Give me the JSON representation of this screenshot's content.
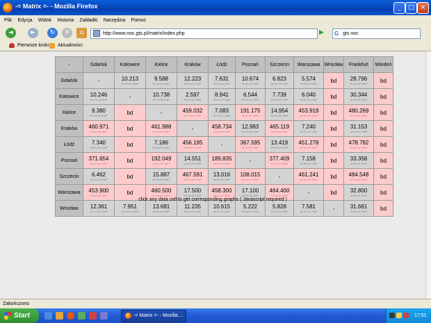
{
  "window": {
    "title": "-= Matrix =- - Mozilla Firefox"
  },
  "window_controls": {
    "minimize": "_",
    "maximize": "□",
    "close": "×"
  },
  "menu": [
    "Plik",
    "Edycja",
    "Widok",
    "Historia",
    "Zakładki",
    "Narzędzia",
    "Pomoc"
  ],
  "nav": {
    "back": "◄",
    "forward": "►",
    "reload": "↻",
    "stop": "✕",
    "home": "⌂",
    "go": "▶"
  },
  "address": {
    "url": "http://www.noc.gts.pl/matrix/index.php"
  },
  "search": {
    "engine_icon": "G",
    "value": "gts noc"
  },
  "bookmarks": [
    "Pierwsze kroki",
    "Aktualności"
  ],
  "matrix": {
    "corner": "-",
    "columns": [
      "Gdańsk",
      "Katowice",
      "Kielce",
      "Kraków",
      "Łódź",
      "Poznań",
      "Szczecin",
      "Warszawa",
      "Wrocław",
      "Frankfurt",
      "Wiedeń"
    ],
    "rows": [
      {
        "name": "Gdańsk",
        "cells": [
          {
            "v": "-",
            "c": "g"
          },
          {
            "v": "10.213",
            "t": "15:31:02 GMT",
            "c": "g"
          },
          {
            "v": "9.588",
            "t": "15:31:02 GMT",
            "c": "g"
          },
          {
            "v": "12.223",
            "t": "15:31:02 GMT",
            "c": "g"
          },
          {
            "v": "7.631",
            "t": "15:31:02 GMT",
            "c": "g"
          },
          {
            "v": "10.674",
            "t": "15:31:02 GMT",
            "c": "g"
          },
          {
            "v": "6.823",
            "t": "15:31:02 GMT",
            "c": "g"
          },
          {
            "v": "5.574",
            "t": "15:31:02 GMT",
            "c": "g"
          },
          {
            "v": "bd",
            "c": "r"
          },
          {
            "v": "28.796",
            "t": "15:31:02 GMT",
            "c": "g"
          },
          {
            "v": "bd",
            "c": "r"
          }
        ]
      },
      {
        "name": "Katowice",
        "cells": [
          {
            "v": "10.246",
            "t": "15:31:02 GMT",
            "c": "g"
          },
          {
            "v": "-",
            "c": "g"
          },
          {
            "v": "10.738",
            "t": "15:31:02 GMT",
            "c": "g"
          },
          {
            "v": "2.597",
            "t": "15:31:02 GMT",
            "c": "g"
          },
          {
            "v": "8.941",
            "t": "15:31:02 GMT",
            "c": "g"
          },
          {
            "v": "6.544",
            "t": "15:31:02 GMT",
            "c": "g"
          },
          {
            "v": "7.739",
            "t": "15:31:02 GMT",
            "c": "g"
          },
          {
            "v": "6.040",
            "t": "15:31:02 GMT",
            "c": "g"
          },
          {
            "v": "bd",
            "c": "r"
          },
          {
            "v": "30.344",
            "t": "15:31:02 GMT",
            "c": "g"
          },
          {
            "v": "bd",
            "c": "r"
          }
        ]
      },
      {
        "name": "Kielce",
        "cells": [
          {
            "v": "9.380",
            "t": "15:31:02 GMT",
            "c": "g"
          },
          {
            "v": "bd",
            "c": "r"
          },
          {
            "v": "-",
            "c": "g"
          },
          {
            "v": "459.032",
            "t": "15:31:02 GMT",
            "c": "r"
          },
          {
            "v": "7.083",
            "t": "15:31:02 GMT",
            "c": "g"
          },
          {
            "v": "191.175",
            "t": "15:31:02 GMT",
            "c": "r"
          },
          {
            "v": "14.954",
            "t": "15:31:02 GMT",
            "c": "g"
          },
          {
            "v": "453.919",
            "t": "15:31:02 GMT",
            "c": "r"
          },
          {
            "v": "bd",
            "c": "r"
          },
          {
            "v": "480.269",
            "t": "15:31:02 GMT",
            "c": "r"
          },
          {
            "v": "bd",
            "c": "r"
          }
        ]
      },
      {
        "name": "Kraków",
        "cells": [
          {
            "v": "460.971",
            "t": "15:31:02 GMT",
            "c": "r"
          },
          {
            "v": "bd",
            "c": "r"
          },
          {
            "v": "461.988",
            "t": "15:31:02 GMT",
            "c": "r"
          },
          {
            "v": "-",
            "c": "g"
          },
          {
            "v": "458.734",
            "t": "15:31:02 GMT",
            "c": "r"
          },
          {
            "v": "12.983",
            "t": "15:31:02 GMT",
            "c": "g"
          },
          {
            "v": "465.119",
            "t": "15:31:02 GMT",
            "c": "r"
          },
          {
            "v": "7.240",
            "t": "15:31:02 GMT",
            "c": "g"
          },
          {
            "v": "bd",
            "c": "r"
          },
          {
            "v": "31.153",
            "t": "15:31:02 GMT",
            "c": "g"
          },
          {
            "v": "bd",
            "c": "r"
          }
        ]
      },
      {
        "name": "Łódź",
        "cells": [
          {
            "v": "7.340",
            "t": "15:31:02 GMT",
            "c": "g"
          },
          {
            "v": "bd",
            "c": "r"
          },
          {
            "v": "7.186",
            "t": "15:31:02 GMT",
            "c": "g"
          },
          {
            "v": "456.195",
            "t": "15:31:02 GMT",
            "c": "r"
          },
          {
            "v": "-",
            "c": "g"
          },
          {
            "v": "367.595",
            "t": "15:31:02 GMT",
            "c": "r"
          },
          {
            "v": "13.419",
            "t": "15:31:02 GMT",
            "c": "g"
          },
          {
            "v": "451.278",
            "t": "15:31:02 GMT",
            "c": "r"
          },
          {
            "v": "bd",
            "c": "r"
          },
          {
            "v": "478.782",
            "t": "15:31:02 GMT",
            "c": "r"
          },
          {
            "v": "bd",
            "c": "r"
          }
        ]
      },
      {
        "name": "Poznań",
        "cells": [
          {
            "v": "371.654",
            "t": "15:31:02 GMT",
            "c": "r"
          },
          {
            "v": "bd",
            "c": "r"
          },
          {
            "v": "192.049",
            "t": "15:31:02 GMT",
            "c": "r"
          },
          {
            "v": "14.551",
            "t": "15:31:02 GMT",
            "c": "g"
          },
          {
            "v": "189.835",
            "t": "15:31:02 GMT",
            "c": "r"
          },
          {
            "v": "-",
            "c": "g"
          },
          {
            "v": "377.409",
            "t": "15:31:02 GMT",
            "c": "r"
          },
          {
            "v": "7.158",
            "t": "15:31:02 GMT",
            "c": "g"
          },
          {
            "v": "bd",
            "c": "r"
          },
          {
            "v": "33.358",
            "t": "15:31:02 GMT",
            "c": "g"
          },
          {
            "v": "bd",
            "c": "r"
          }
        ]
      },
      {
        "name": "Szczecin",
        "cells": [
          {
            "v": "6.462",
            "t": "15:31:02 GMT",
            "c": "g"
          },
          {
            "v": "bd",
            "c": "r"
          },
          {
            "v": "15.887",
            "t": "15:31:02 GMT",
            "c": "g"
          },
          {
            "v": "467.591",
            "t": "15:31:02 GMT",
            "c": "r"
          },
          {
            "v": "13.016",
            "t": "15:31:02 GMT",
            "c": "g"
          },
          {
            "v": "108.015",
            "t": "15:31:02 GMT",
            "c": "r"
          },
          {
            "v": "-",
            "c": "g"
          },
          {
            "v": "461.241",
            "t": "15:31:02 GMT",
            "c": "r"
          },
          {
            "v": "bd",
            "c": "r"
          },
          {
            "v": "484.548",
            "t": "15:31:02 GMT",
            "c": "r"
          },
          {
            "v": "bd",
            "c": "r"
          }
        ]
      },
      {
        "name": "Warszawa",
        "cells": [
          {
            "v": "453.900",
            "t": "15:31:02 GMT",
            "c": "r"
          },
          {
            "v": "bd",
            "c": "r"
          },
          {
            "v": "460.500",
            "t": "15:31:02 GMT",
            "c": "r"
          },
          {
            "v": "17.500",
            "t": "15:31:02 GMT",
            "c": "g"
          },
          {
            "v": "458.300",
            "t": "15:31:02 GMT",
            "c": "r"
          },
          {
            "v": "17.100",
            "t": "15:31:02 GMT",
            "c": "g"
          },
          {
            "v": "464.400",
            "t": "15:31:02 GMT",
            "c": "r"
          },
          {
            "v": "-",
            "c": "g"
          },
          {
            "v": "bd",
            "c": "r"
          },
          {
            "v": "32.800",
            "t": "15:31:02 GMT",
            "c": "g"
          },
          {
            "v": "bd",
            "c": "r"
          }
        ]
      },
      {
        "name": "Wrocław",
        "cells": [
          {
            "v": "12.361",
            "t": "15:31:02 GMT",
            "c": "g"
          },
          {
            "v": "7.951",
            "t": "15:31:02 GMT",
            "c": "g"
          },
          {
            "v": "13.681",
            "t": "15:31:02 GMT",
            "c": "g"
          },
          {
            "v": "11.235",
            "t": "15:31:02 GMT",
            "c": "g"
          },
          {
            "v": "10.615",
            "t": "15:31:02 GMT",
            "c": "g"
          },
          {
            "v": "5.222",
            "t": "15:31:02 GMT",
            "c": "g"
          },
          {
            "v": "5.828",
            "t": "15:31:02 GMT",
            "c": "g"
          },
          {
            "v": "7.581",
            "t": "15:31:02 GMT",
            "c": "g"
          },
          {
            "v": "-",
            "c": "g"
          },
          {
            "v": "31.661",
            "t": "15:31:02 GMT",
            "c": "g"
          },
          {
            "v": "bd",
            "c": "r"
          }
        ]
      }
    ]
  },
  "note": "click any data cell to get corresponding graphs ( Javascript required )",
  "status": "Zakończono",
  "taskbar": {
    "start": "Start",
    "task": "-= Matrix =- - Mozilla ...",
    "clock": "17:51"
  },
  "colors": {
    "ok_cell": "#d4d4d4",
    "alert_cell": "#fccccc",
    "header": "#c0c0c0",
    "titlebar": "#0a54c8"
  }
}
